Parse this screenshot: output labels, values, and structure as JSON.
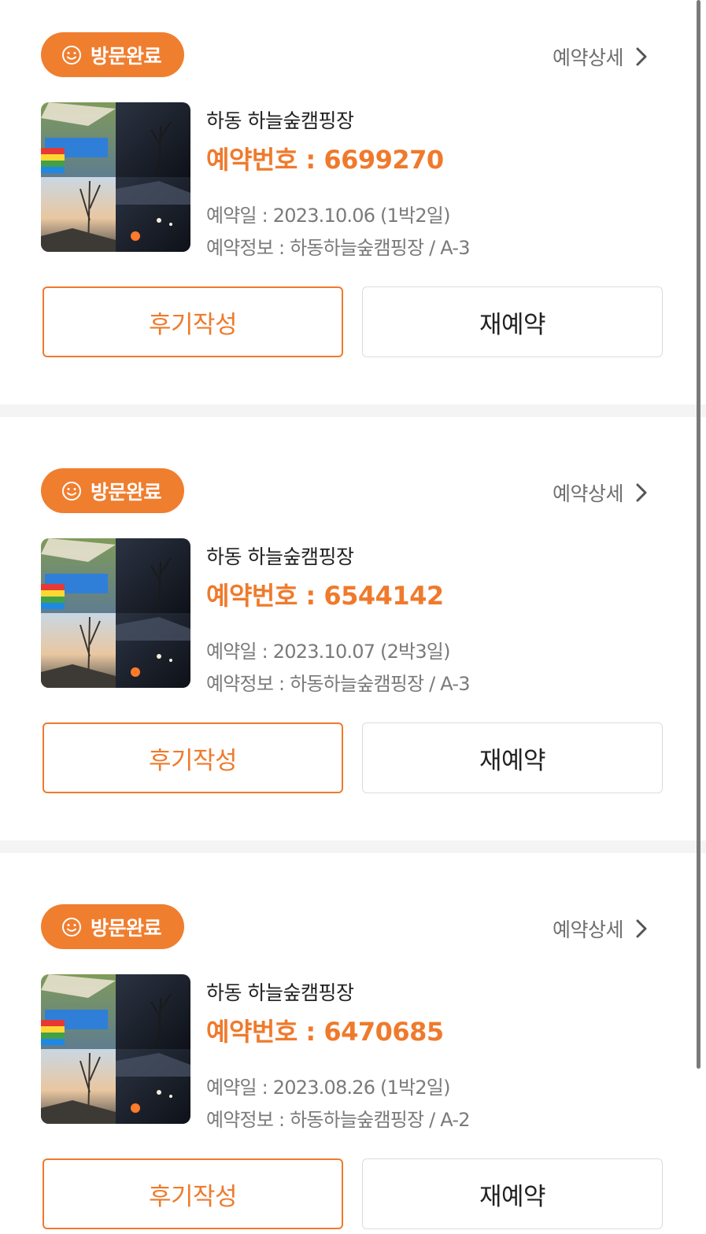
{
  "colors": {
    "accent": "#ef7a2c",
    "badge_bg": "#f07e2f",
    "muted_text": "#7a7a7a",
    "divider": "#f4f4f4"
  },
  "reservations": [
    {
      "status_badge": "방문완료",
      "status_icon": "smile-icon",
      "detail_link": "예약상세",
      "detail_icon": "chevron-right-icon",
      "thumbnail": "campsite-collage-image",
      "site_name": "하동 하늘숲캠핑장",
      "reservation_no": "예약번호 : 6699270",
      "reserved_date": "예약일 : 2023.10.06 (1박2일)",
      "reservation_info": "예약정보 : 하동하늘숲캠핑장 / A-3",
      "review_button": "후기작성",
      "rebook_button": "재예약"
    },
    {
      "status_badge": "방문완료",
      "status_icon": "smile-icon",
      "detail_link": "예약상세",
      "detail_icon": "chevron-right-icon",
      "thumbnail": "campsite-collage-image",
      "site_name": "하동 하늘숲캠핑장",
      "reservation_no": "예약번호 : 6544142",
      "reserved_date": "예약일 : 2023.10.07 (2박3일)",
      "reservation_info": "예약정보 : 하동하늘숲캠핑장 / A-3",
      "review_button": "후기작성",
      "rebook_button": "재예약"
    },
    {
      "status_badge": "방문완료",
      "status_icon": "smile-icon",
      "detail_link": "예약상세",
      "detail_icon": "chevron-right-icon",
      "thumbnail": "campsite-collage-image",
      "site_name": "하동 하늘숲캠핑장",
      "reservation_no": "예약번호 : 6470685",
      "reserved_date": "예약일 : 2023.08.26 (1박2일)",
      "reservation_info": "예약정보 : 하동하늘숲캠핑장 / A-2",
      "review_button": "후기작성",
      "rebook_button": "재예약"
    }
  ]
}
